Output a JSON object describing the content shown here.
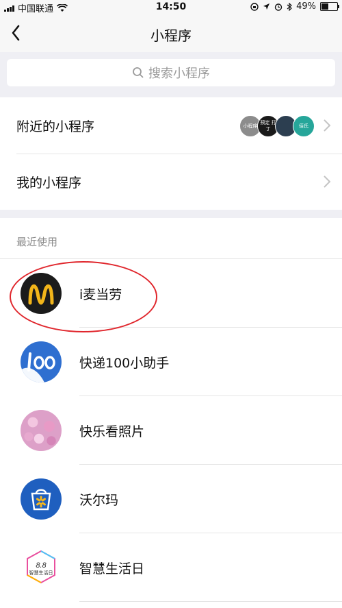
{
  "status": {
    "carrier": "中国联通",
    "time": "14:50",
    "battery": "49%",
    "battery_level": 0.49
  },
  "nav": {
    "title": "小程序"
  },
  "search": {
    "placeholder": "搜索小程序"
  },
  "menu": {
    "nearby_label": "附近的小程序",
    "mine_label": "我的小程序",
    "nearby_avatars": [
      {
        "text": "小程序",
        "color": "#8c8c8c"
      },
      {
        "text": "预定\n打丁",
        "color": "#1a1a1a"
      },
      {
        "text": "",
        "color": "#2c3e50"
      },
      {
        "text": "佰氏",
        "color": "#26a69a"
      }
    ]
  },
  "recent": {
    "section_title": "最近使用",
    "items": [
      {
        "name": "i麦当劳",
        "icon": "mcdonalds-icon"
      },
      {
        "name": "快递100小助手",
        "icon": "kuaidi100-icon"
      },
      {
        "name": "快乐看照片",
        "icon": "flowers-photo-icon"
      },
      {
        "name": "沃尔玛",
        "icon": "walmart-icon"
      },
      {
        "name": "智慧生活日",
        "icon": "smart-life-day-icon"
      }
    ],
    "badge_88": "8.8",
    "badge_88_sub": "智慧生活日"
  },
  "colors": {
    "highlight": "#e0262c",
    "mcd_bg": "#1b1b1b",
    "mcd_arch": "#f2b51a",
    "kuaidi_blue": "#2f6fd0",
    "walmart_blue": "#1f5fbf",
    "walmart_yellow": "#f6b71d"
  }
}
